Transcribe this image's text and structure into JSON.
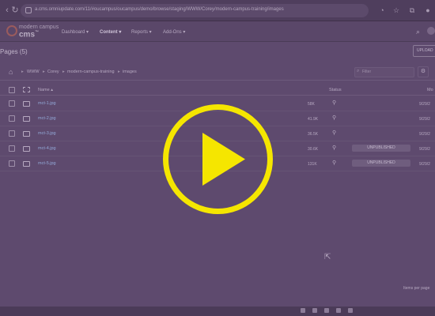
{
  "browser": {
    "url": "a.cms.omniupdate.com/11/#oucampus/oucampus/demo/browse/staging/WWW/Corey/modern-campus-training/images"
  },
  "app": {
    "logo_line1": "modern campus",
    "logo_line2": "cms",
    "logo_mark": "™",
    "menu": [
      "Dashboard",
      "Content",
      "Reports",
      "Add-Ons"
    ],
    "active_menu_index": 1
  },
  "page": {
    "title": "Pages (5)",
    "upload_label": "UPLOAD"
  },
  "breadcrumb": [
    "WWW",
    "Corey",
    "modern-campus-training",
    "images"
  ],
  "filter": {
    "placeholder": "Filter"
  },
  "table": {
    "headers": {
      "name": "Name",
      "status": "Status",
      "modified": "Mo"
    },
    "rows": [
      {
        "name": "mct-1.jpg",
        "size": "58K",
        "status": "",
        "date": "9/29/2"
      },
      {
        "name": "mct-2.jpg",
        "size": "41.9K",
        "status": "",
        "date": "9/29/2"
      },
      {
        "name": "mct-3.jpg",
        "size": "36.5K",
        "status": "",
        "date": "9/29/2"
      },
      {
        "name": "mct-4.jpg",
        "size": "30.6K",
        "status": "UNPUBLISHED",
        "date": "9/29/2"
      },
      {
        "name": "mct-5.jpg",
        "size": "131K",
        "status": "UNPUBLISHED",
        "date": "9/29/2"
      }
    ]
  },
  "footer": {
    "items_per_page_label": "Items per page"
  },
  "overlay": {
    "icon": "play-icon",
    "color": "#f5e600"
  }
}
